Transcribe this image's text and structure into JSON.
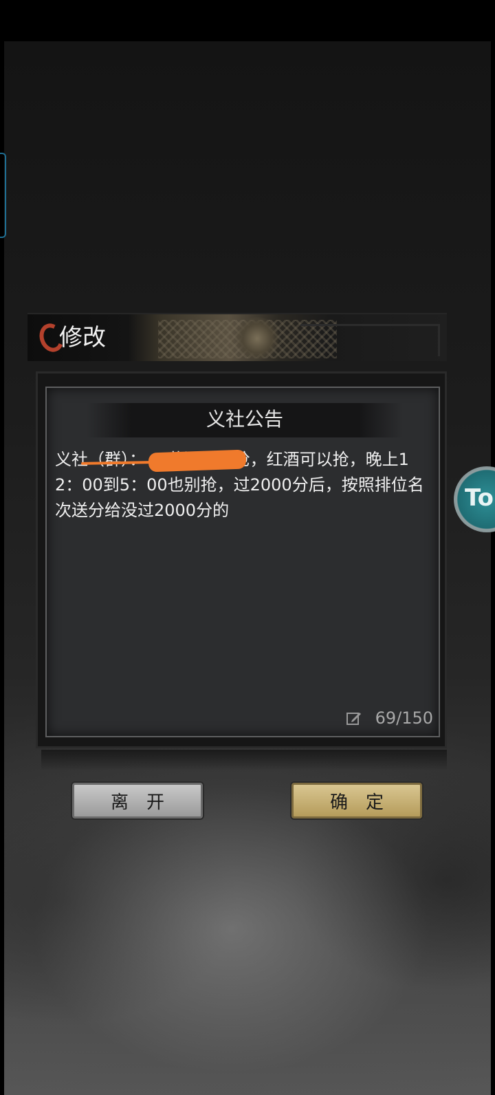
{
  "dialog": {
    "title": "修改"
  },
  "notice": {
    "header": "义社公告",
    "body": "义社（群）：                  ，黄酒不能抢，红酒可以抢，晚上12：00到5：00也别抢，过2000分后，按照排位名次送分给没过2000分的",
    "counter": "69/150"
  },
  "buttons": {
    "leave": "离开",
    "confirm": "确定"
  },
  "overlay": {
    "badge_text": "To"
  },
  "icons": {
    "title_icon": "crescent-icon",
    "edit_icon": "edit-icon"
  },
  "colors": {
    "redaction": "#f07a2c",
    "confirm_button": "#c9b273",
    "leave_button": "#b0b0b0",
    "badge": "#2a8a90"
  }
}
